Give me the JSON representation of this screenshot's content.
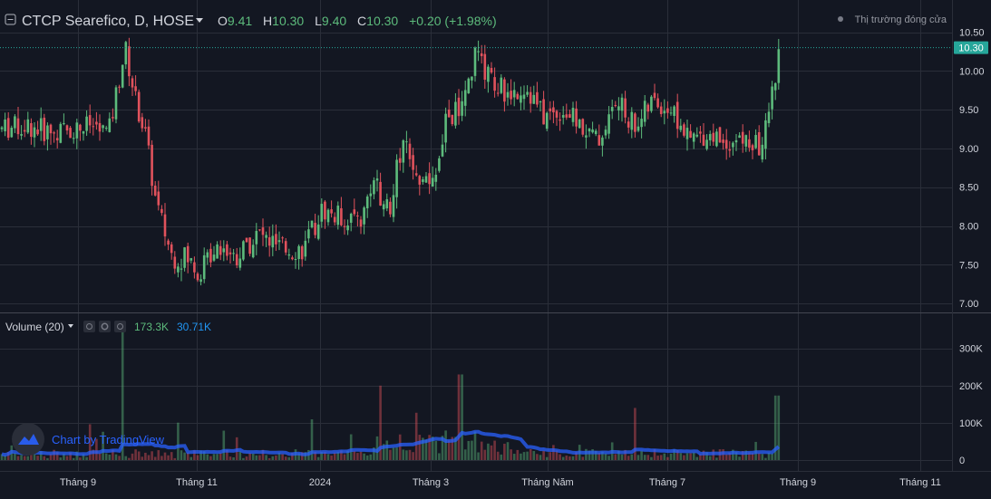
{
  "header": {
    "symbol_title": "CTCP Searefico, D, HOSE",
    "o_label": "O",
    "o_value": "9.41",
    "h_label": "H",
    "h_value": "10.30",
    "l_label": "L",
    "l_value": "9.40",
    "c_label": "C",
    "c_value": "10.30",
    "change": "+0.20 (+1.98%)",
    "market_status": "Thị trường đóng cửa"
  },
  "volume_legend": {
    "label": "Volume (20)",
    "value": "173.3K",
    "ma_value": "30.71K"
  },
  "watermark": {
    "text": "Chart by TradingView"
  },
  "price_axis": {
    "ticks": [
      "10.50",
      "10.00",
      "9.50",
      "9.00",
      "8.50",
      "8.00",
      "7.50",
      "7.00"
    ],
    "last_price_label": "10.30"
  },
  "volume_axis": {
    "ticks": [
      "300K",
      "200K",
      "100K",
      "0"
    ]
  },
  "time_axis": {
    "labels": [
      "Tháng 9",
      "Tháng 11",
      "2024",
      "Tháng 3",
      "Tháng Năm",
      "Tháng 7",
      "Tháng 9",
      "Tháng 11"
    ]
  },
  "colors": {
    "background": "#131722",
    "grid": "#2a2e39",
    "up": "#5dbb7c",
    "down": "#e0525c",
    "text": "#d1d4dc",
    "muted": "#787b86",
    "ma_line": "#2962ff",
    "last_price": "#26a69a"
  },
  "chart_data": {
    "type": "candlestick",
    "title": "CTCP Searefico, D, HOSE",
    "y_range": [
      6.9,
      10.6
    ],
    "last_price": 10.3,
    "volume_range": [
      0,
      380000
    ],
    "key_closes": [
      {
        "period": "Tháng 8 (2023)",
        "close": 9.2
      },
      {
        "period": "Tháng 9 peak",
        "close": 10.5
      },
      {
        "period": "Tháng 11 low",
        "close": 7.3
      },
      {
        "period": "Tháng 1 2024",
        "close": 7.8
      },
      {
        "period": "Tháng 3 peak",
        "close": 10.4
      },
      {
        "period": "Tháng Năm",
        "close": 9.5
      },
      {
        "period": "Tháng 7",
        "close": 9.0
      },
      {
        "period": "Tháng 8 last",
        "close": 10.3
      }
    ]
  }
}
